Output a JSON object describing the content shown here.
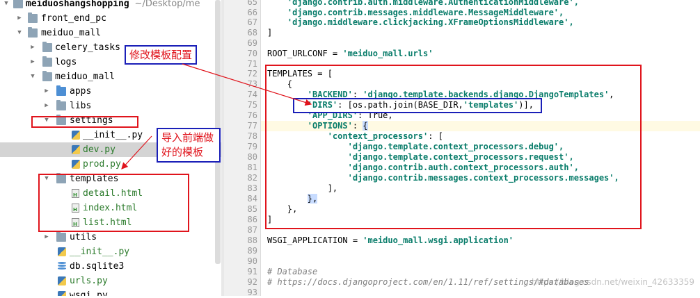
{
  "project_tree": {
    "root": {
      "name": "meiduoshangshopping",
      "path": "~/Desktop/me"
    },
    "items": [
      {
        "label": "front_end_pc",
        "kind": "folder"
      },
      {
        "label": "meiduo_mall",
        "kind": "folder"
      },
      {
        "label": "celery_tasks",
        "kind": "folder"
      },
      {
        "label": "logs",
        "kind": "folder"
      },
      {
        "label": "meiduo_mall",
        "kind": "folder"
      },
      {
        "label": "apps",
        "kind": "folder-blue"
      },
      {
        "label": "libs",
        "kind": "folder"
      },
      {
        "label": "settings",
        "kind": "folder"
      },
      {
        "label": "__init__.py",
        "kind": "py"
      },
      {
        "label": "dev.py",
        "kind": "py"
      },
      {
        "label": "prod.py",
        "kind": "py"
      },
      {
        "label": "templates",
        "kind": "folder"
      },
      {
        "label": "detail.html",
        "kind": "html"
      },
      {
        "label": "index.html",
        "kind": "html"
      },
      {
        "label": "list.html",
        "kind": "html"
      },
      {
        "label": "utils",
        "kind": "folder"
      },
      {
        "label": "__init__.py",
        "kind": "py"
      },
      {
        "label": "db.sqlite3",
        "kind": "db"
      },
      {
        "label": "urls.py",
        "kind": "py"
      },
      {
        "label": "wsgi.py",
        "kind": "py"
      }
    ]
  },
  "editor": {
    "line_numbers": [
      "65",
      "66",
      "67",
      "68",
      "69",
      "70",
      "71",
      "72",
      "73",
      "74",
      "75",
      "76",
      "77",
      "78",
      "79",
      "80",
      "81",
      "82",
      "83",
      "84",
      "85",
      "86",
      "87",
      "88",
      "89",
      "90",
      "91",
      "92",
      "93"
    ],
    "lines": {
      "l65_str": "'django.contrib.auth.middleware.AuthenticationMiddleware',",
      "l66_str": "'django.contrib.messages.middleware.MessageMiddleware',",
      "l67_str": "'django.middleware.clickjacking.XFrameOptionsMiddleware',",
      "l68": "]",
      "l70_pre": "ROOT_URLCONF = ",
      "l70_str": "'meiduo_mall.urls'",
      "l72": "TEMPLATES = [",
      "l73": "    {",
      "l74_key": "'BACKEND'",
      "l74_str": "'django.template.backends.django.DjangoTemplates'",
      "l75_key": "'DIRS'",
      "l75_mid": ": [os.path.join(BASE_DIR,",
      "l75_str": "'templates'",
      "l75_end": ")],",
      "l76_key": "'APP_DIRS'",
      "l76_val": ": True,",
      "l77_key": "'OPTIONS'",
      "l77_brace": "{",
      "l78_key": "'context_processors'",
      "l78_end": ": [",
      "l79": "'django.template.context_processors.debug',",
      "l80": "'django.template.context_processors.request',",
      "l81": "'django.contrib.auth.context_processors.auth',",
      "l82": "'django.contrib.messages.context_processors.messages',",
      "l83": "],",
      "l84": "},",
      "l85": "},",
      "l86": "]",
      "l88_pre": "WSGI_APPLICATION = ",
      "l88_str": "'meiduo_mall.wsgi.application'",
      "l91": "# Database",
      "l92": "# https://docs.djangoproject.com/en/1.11/ref/settings/#databases"
    }
  },
  "annotations": {
    "modify_template_config": "修改模板配置",
    "import_frontend_line1": "导入前端做",
    "import_frontend_line2": "好的模板"
  },
  "watermark": "https://blog.csdn.net/weixin_42633359"
}
